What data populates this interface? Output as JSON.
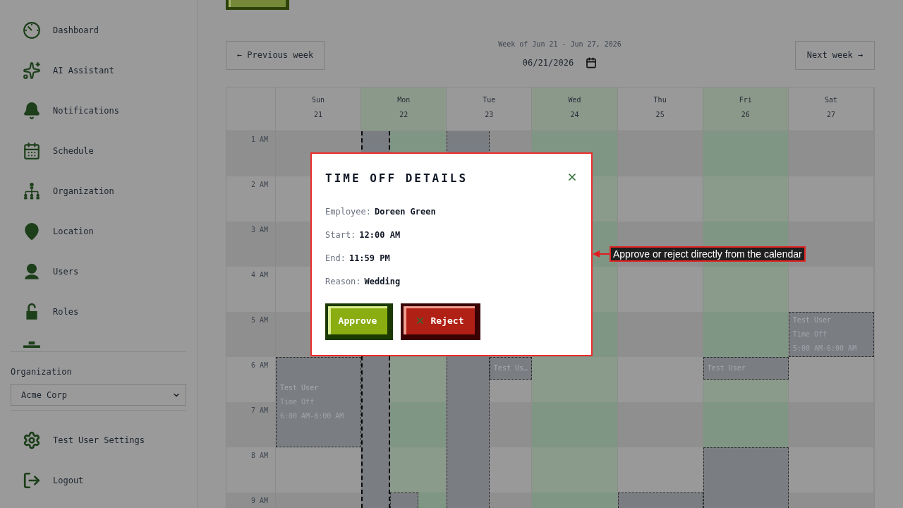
{
  "sidebar": {
    "nav_items": [
      {
        "label": "Dashboard",
        "selected": false
      },
      {
        "label": "AI Assistant",
        "selected": false
      },
      {
        "label": "Notifications",
        "selected": false
      },
      {
        "label": "Schedule",
        "selected": false
      },
      {
        "label": "Organization",
        "selected": false
      },
      {
        "label": "Location",
        "selected": false
      },
      {
        "label": "Users",
        "selected": false
      },
      {
        "label": "Roles",
        "selected": false
      }
    ],
    "organization": {
      "label": "Organization",
      "value": "Acme Corp"
    },
    "footer_items": [
      {
        "label": "Test User Settings"
      },
      {
        "label": "Logout"
      }
    ]
  },
  "week_nav": {
    "previous": "← Previous week",
    "range": "Week of Jun 21 - Jun 27, 2026",
    "date": "06/21/2026",
    "next": "Next week →"
  },
  "calendar": {
    "days": [
      {
        "name": "Sun",
        "date": "21",
        "shaded": false
      },
      {
        "name": "Mon",
        "date": "22",
        "shaded": true
      },
      {
        "name": "Tue",
        "date": "23",
        "shaded": false
      },
      {
        "name": "Wed",
        "date": "24",
        "shaded": true
      },
      {
        "name": "Thu",
        "date": "25",
        "shaded": false
      },
      {
        "name": "Fri",
        "date": "26",
        "shaded": true
      },
      {
        "name": "Sat",
        "date": "27",
        "shaded": false
      }
    ],
    "hours": [
      "1 AM",
      "2 AM",
      "3 AM",
      "4 AM",
      "5 AM",
      "6 AM",
      "7 AM",
      "8 AM",
      "9 AM"
    ],
    "events": [
      {
        "selected": true
      },
      {
        "selected": false
      },
      {
        "title": "Test User",
        "type": "Time Off",
        "time": "6:00 AM-8:00 AM",
        "selected": false
      },
      {
        "title": "Test Us…",
        "selected": false
      },
      {
        "title": "Test User",
        "selected": false
      },
      {
        "title": "Test User",
        "type": "Time Off",
        "time": "5:00 AM-6:00 AM",
        "selected": false
      },
      {
        "selected": false
      },
      {
        "selected": false
      },
      {
        "selected": false
      }
    ]
  },
  "dialog": {
    "title": "TIME OFF DETAILS",
    "fields": [
      {
        "label": "Employee:",
        "value": "Doreen Green"
      },
      {
        "label": "Start:",
        "value": "12:00 AM"
      },
      {
        "label": "End:",
        "value": "11:59 PM"
      },
      {
        "label": "Reason:",
        "value": "Wedding"
      }
    ],
    "actions": [
      {
        "label": "Approve",
        "kind": "approve"
      },
      {
        "label": "Reject",
        "kind": "reject"
      }
    ]
  },
  "annotation": {
    "text": "Approve or reject directly from the calendar"
  }
}
